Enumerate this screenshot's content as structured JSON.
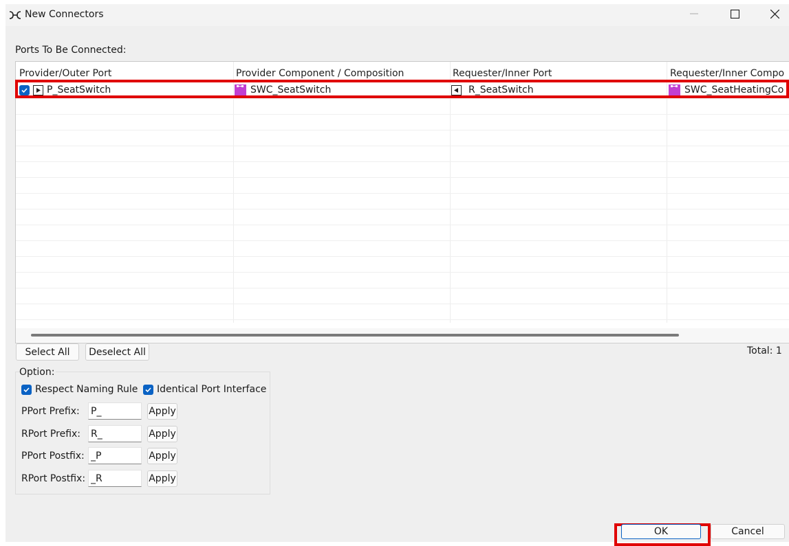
{
  "window": {
    "title": "New Connectors",
    "icons": {
      "app": "connector-icon",
      "minimize": "minimize-icon",
      "maximize": "maximize-icon",
      "close": "close-icon"
    }
  },
  "ports_section": {
    "label": "Ports To Be Connected:"
  },
  "table": {
    "columns": [
      "Provider/Outer Port",
      "Provider Component / Composition",
      "Requester/Inner Port",
      "Requester/Inner Compo"
    ],
    "rows": [
      {
        "checked": true,
        "provider_port": "P_SeatSwitch",
        "provider_component": "SWC_SeatSwitch",
        "requester_port": "R_SeatSwitch",
        "requester_component": "SWC_SeatHeatingCo"
      }
    ]
  },
  "buttons": {
    "select_all": "Select All",
    "deselect_all": "Deselect All",
    "ok": "OK",
    "cancel": "Cancel"
  },
  "total_label": "Total: 1",
  "option": {
    "title": "Option:",
    "respect_naming_rule": {
      "label": "Respect Naming Rule",
      "checked": true
    },
    "identical_port_interface": {
      "label": "Identical Port Interface",
      "checked": true
    },
    "fields": [
      {
        "label": "PPort Prefix:",
        "value": "P_",
        "apply": "Apply"
      },
      {
        "label": "RPort Prefix:",
        "value": "R_",
        "apply": "Apply"
      },
      {
        "label": "PPort Postfix:",
        "value": "_P",
        "apply": "Apply"
      },
      {
        "label": "RPort Postfix:",
        "value": "_R",
        "apply": "Apply"
      }
    ]
  },
  "colors": {
    "accent": "#0a62c4",
    "highlight": "#e00000",
    "component_icon": "#c23fd1"
  }
}
